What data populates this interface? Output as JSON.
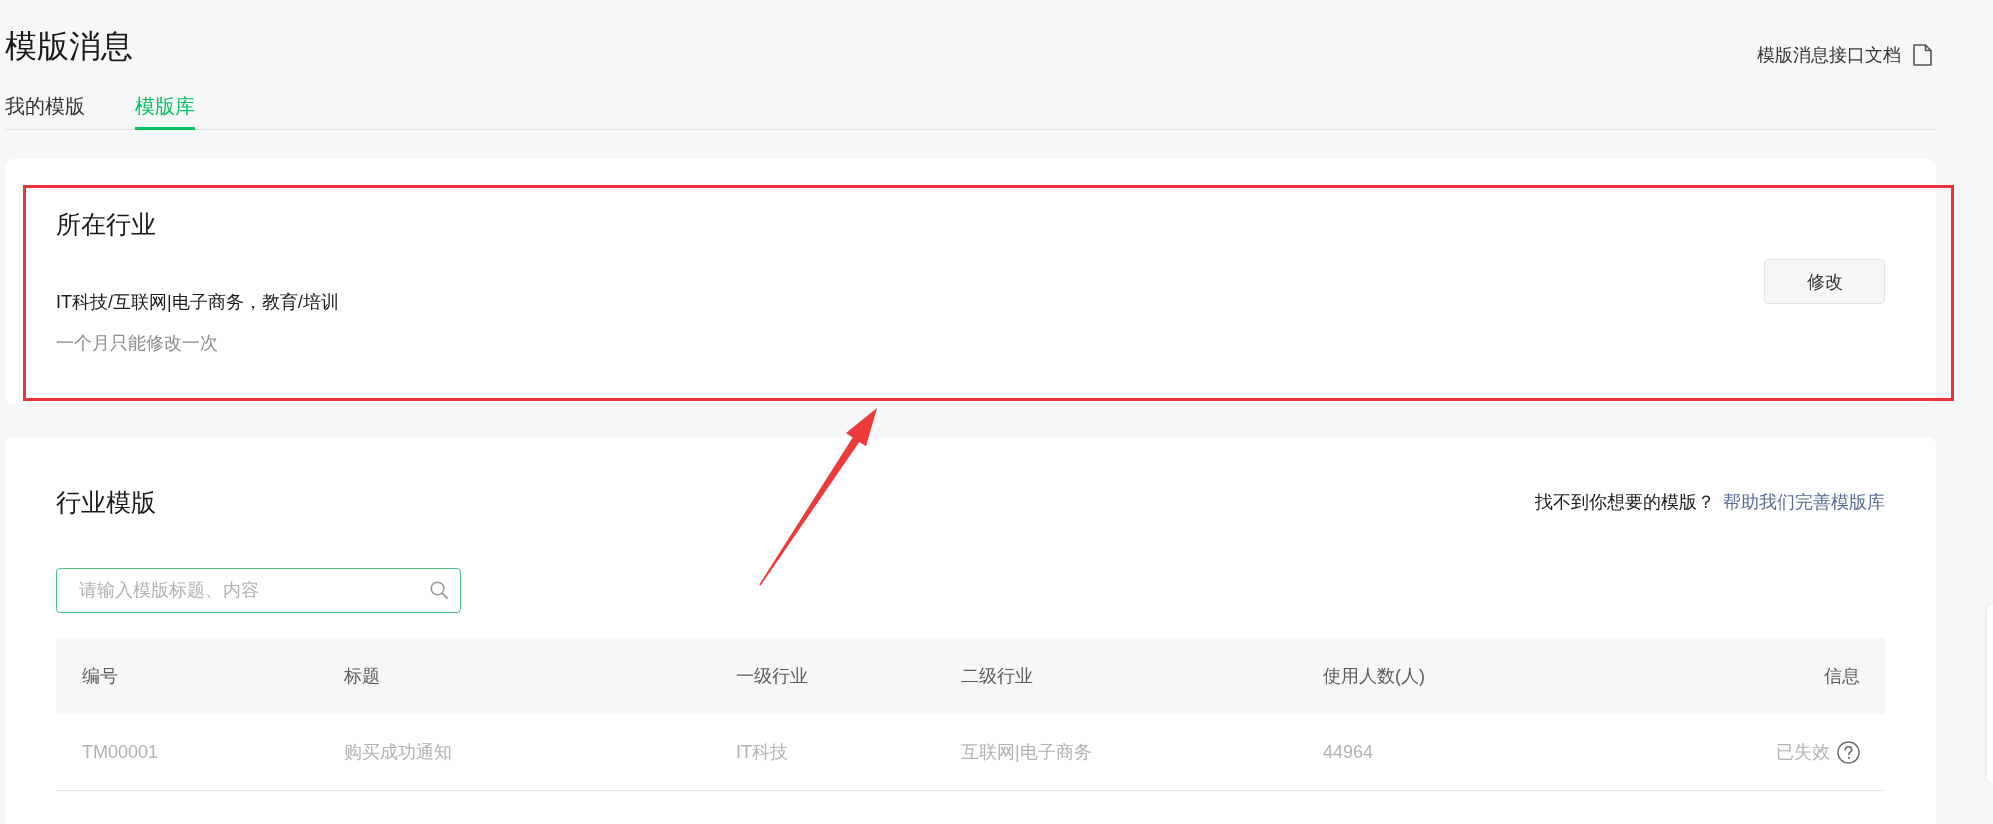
{
  "page": {
    "title": "模版消息",
    "doc_link": "模版消息接口文档"
  },
  "tabs": [
    {
      "label": "我的模版",
      "selected": false
    },
    {
      "label": "模版库",
      "selected": true
    }
  ],
  "industry_card": {
    "title": "所在行业",
    "industries": "IT科技/互联网|电子商务，教育/培训",
    "note": "一个月只能修改一次",
    "edit_button": "修改"
  },
  "templates_card": {
    "title": "行业模版",
    "help_prompt": "找不到你想要的模版？",
    "help_link": "帮助我们完善模版库",
    "search": {
      "placeholder": "请输入模版标题、内容"
    },
    "table": {
      "columns": [
        "编号",
        "标题",
        "一级行业",
        "二级行业",
        "使用人数(人)",
        "信息"
      ],
      "rows": [
        {
          "cells": [
            "TM00001",
            "购买成功通知",
            "IT科技",
            "互联网|电子商务",
            "44964"
          ],
          "status": "已失效",
          "disabled": true
        }
      ]
    }
  }
}
